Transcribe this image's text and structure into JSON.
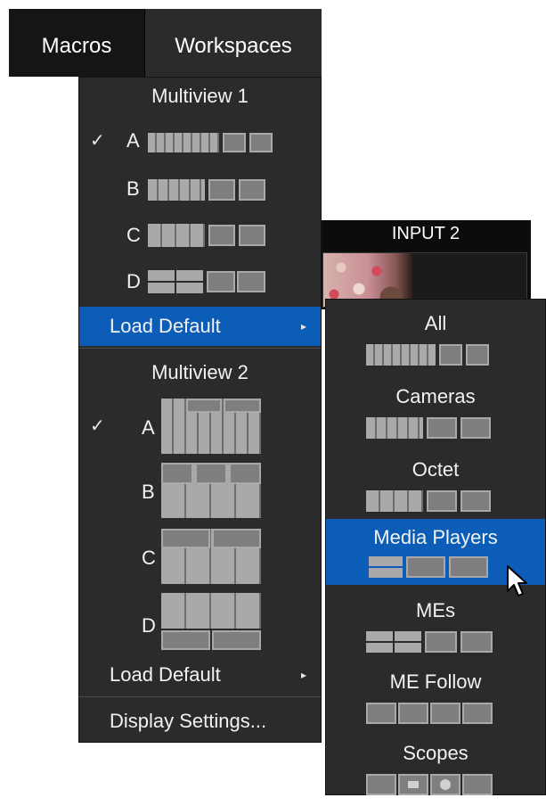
{
  "menubar": {
    "macros": "Macros",
    "workspaces": "Workspaces"
  },
  "input_panel": {
    "label": "INPUT 2"
  },
  "menu": {
    "multiview1": {
      "header": "Multiview 1",
      "options": [
        {
          "letter": "A",
          "checked": true
        },
        {
          "letter": "B",
          "checked": false
        },
        {
          "letter": "C",
          "checked": false
        },
        {
          "letter": "D",
          "checked": false
        }
      ]
    },
    "load_default_1": "Load Default",
    "multiview2": {
      "header": "Multiview 2",
      "options": [
        {
          "letter": "A",
          "checked": true
        },
        {
          "letter": "B",
          "checked": false
        },
        {
          "letter": "C",
          "checked": false
        },
        {
          "letter": "D",
          "checked": false
        }
      ]
    },
    "load_default_2": "Load Default",
    "display_settings": "Display Settings...",
    "check_glyph": "✓",
    "arrow_glyph": "▸",
    "highlight_color": "#0b5db7"
  },
  "submenu": {
    "items": [
      {
        "label": "All",
        "highlighted": false
      },
      {
        "label": "Cameras",
        "highlighted": false
      },
      {
        "label": "Octet",
        "highlighted": false
      },
      {
        "label": "Media Players",
        "highlighted": true
      },
      {
        "label": "MEs",
        "highlighted": false
      },
      {
        "label": "ME Follow",
        "highlighted": false
      },
      {
        "label": "Scopes",
        "highlighted": false
      }
    ]
  }
}
